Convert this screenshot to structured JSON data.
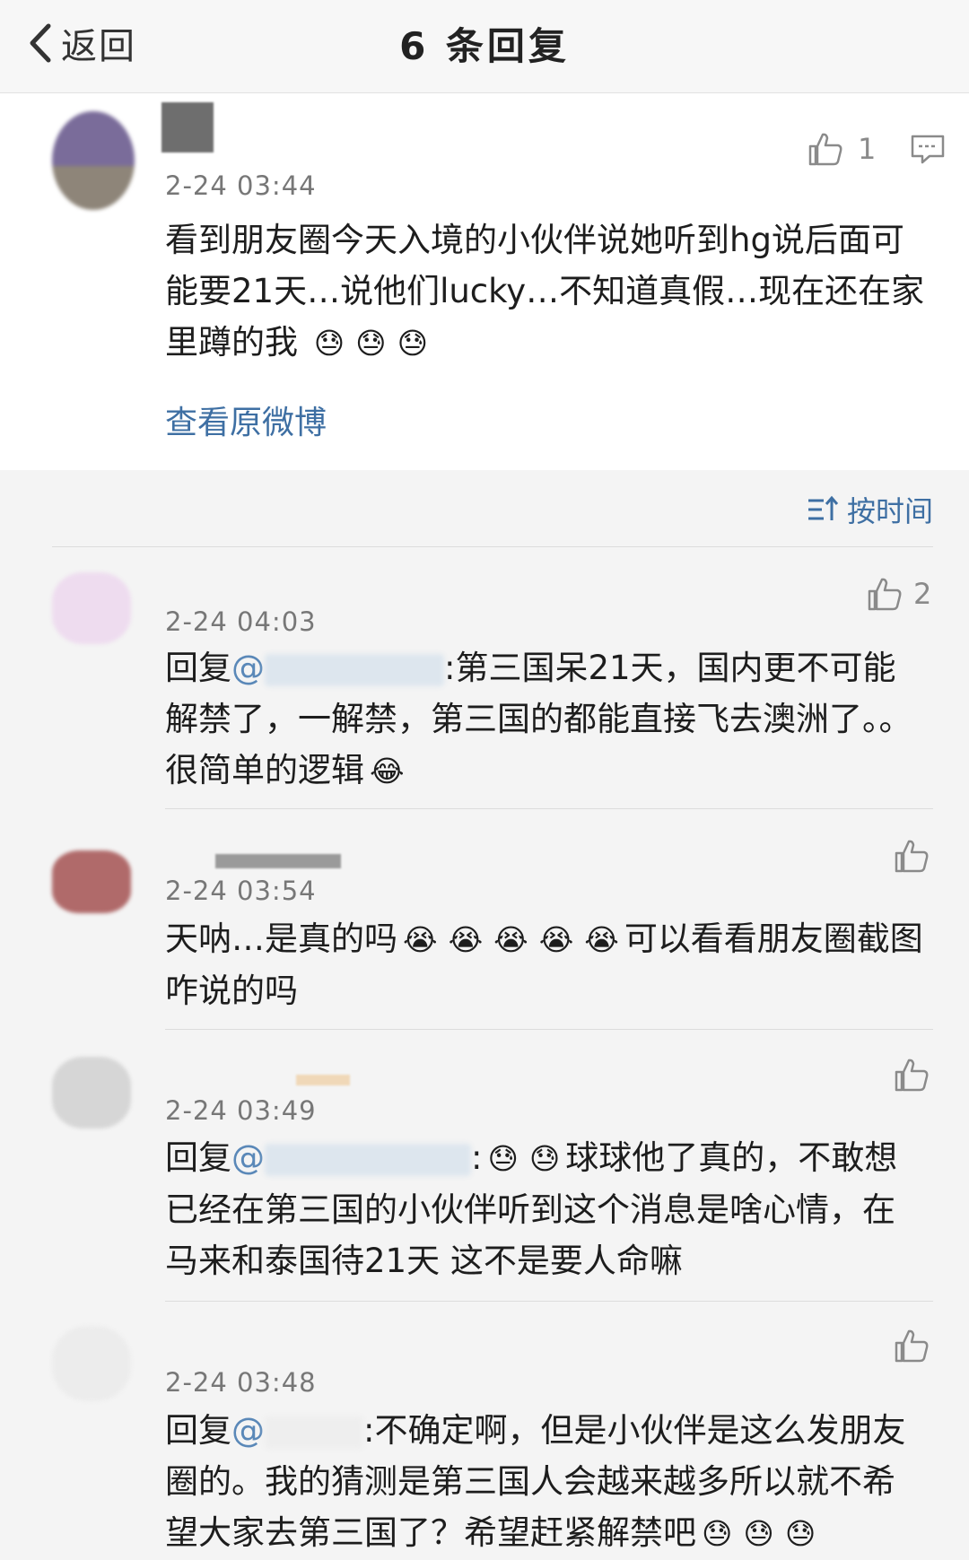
{
  "header": {
    "back_label": "返回",
    "title": "6 条回复"
  },
  "main_post": {
    "timestamp": "2-24 03:44",
    "content": "看到朋友圈今天入境的小伙伴说她听到hg说后面可能要21天…说他们lucky…不知道真假…现在还在家里蹲的我",
    "emojis": [
      "😓",
      "😓",
      "😓"
    ],
    "likes": "1",
    "view_original": "查看原微博"
  },
  "sort_label": "按时间",
  "replies": [
    {
      "timestamp": "2-24 04:03",
      "likes": "2",
      "prefix": "回复",
      "mention": "@",
      "text": ":第三国呆21天，国内更不可能解禁了，一解禁，第三国的都能直接飞去澳洲了。。很简单的逻辑",
      "emojis": [
        "😂"
      ]
    },
    {
      "timestamp": "2-24 03:54",
      "likes": "",
      "prefix": "",
      "mention": "",
      "text": "天呐…是真的吗",
      "emojis": [
        "😭",
        "😭",
        "😭",
        "😭",
        "😭"
      ],
      "text2": "可以看看朋友圈截图咋说的吗"
    },
    {
      "timestamp": "2-24 03:49",
      "likes": "",
      "prefix": "回复",
      "mention": "@",
      "text": "球球他了真的，不敢想已经在第三国的小伙伴听到这个消息是啥心情，在马来和泰国待21天 这不是要人命嘛",
      "emojis": [
        "😓",
        "😓"
      ]
    },
    {
      "timestamp": "2-24 03:48",
      "likes": "",
      "prefix": "回复",
      "mention": "@",
      "text": ":不确定啊，但是小伙伴是这么发朋友圈的。我的猜测是第三国人会越来越多所以就不希望大家去第三国了？希望赶紧解禁吧",
      "emojis": [
        "😓",
        "😓",
        "😓"
      ]
    }
  ],
  "colors": {
    "link": "#3e6fa3",
    "mention": "#5a88b8",
    "header_bg": "#f7f7f7",
    "page_bg": "#f4f4f4"
  }
}
